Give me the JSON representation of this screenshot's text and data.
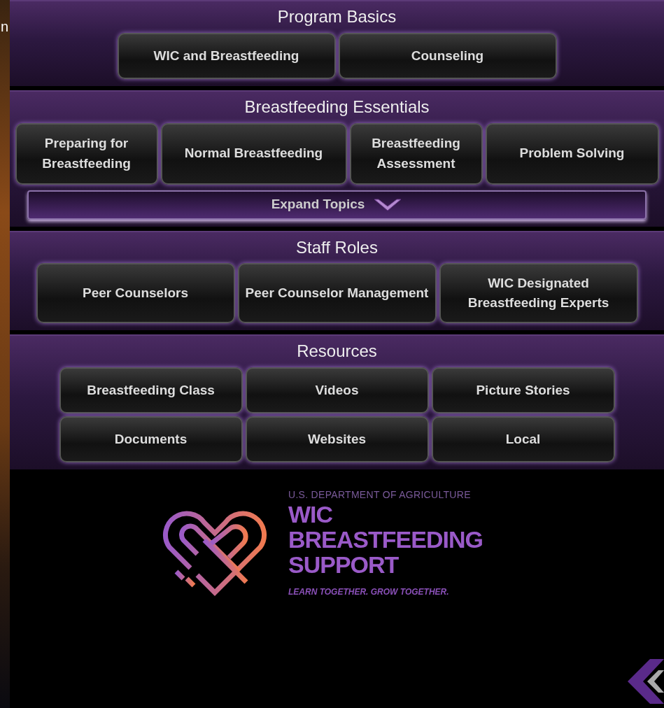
{
  "edge_text": "n",
  "sections": [
    {
      "title": "Program Basics",
      "buttons": [
        {
          "label": "WIC and Breastfeeding"
        },
        {
          "label": "Counseling"
        }
      ]
    },
    {
      "title": "Breastfeeding Essentials",
      "buttons": [
        {
          "label": "Preparing for Breastfeeding"
        },
        {
          "label": "Normal Breastfeeding"
        },
        {
          "label": "Breastfeeding Assessment"
        },
        {
          "label": "Problem Solving"
        }
      ],
      "expand": {
        "label": "Expand Topics",
        "expanded": false
      }
    },
    {
      "title": "Staff Roles",
      "buttons": [
        {
          "label": "Peer Counselors"
        },
        {
          "label": "Peer Counselor Management"
        },
        {
          "label": "WIC Designated Breastfeeding Experts"
        }
      ]
    },
    {
      "title": "Resources",
      "buttons": [
        {
          "label": "Breastfeeding Class"
        },
        {
          "label": "Videos"
        },
        {
          "label": "Picture Stories"
        },
        {
          "label": "Documents"
        },
        {
          "label": "Websites"
        },
        {
          "label": "Local"
        }
      ]
    }
  ],
  "footer": {
    "department": "U.S. DEPARTMENT OF AGRICULTURE",
    "brand_lines": [
      "WIC",
      "BREASTFEEDING",
      "SUPPORT"
    ],
    "tagline": "LEARN TOGETHER. GROW TOGETHER."
  }
}
